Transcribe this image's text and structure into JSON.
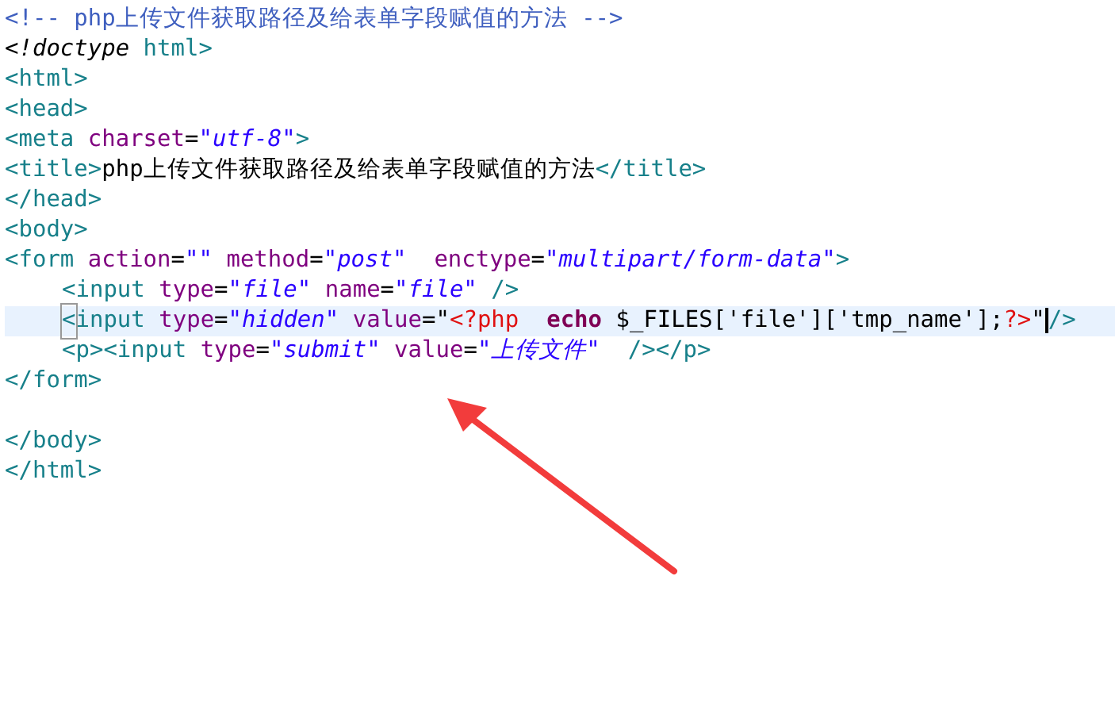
{
  "editor": {
    "lines": [
      {
        "highlighted": false,
        "tokens": [
          {
            "kind": "comment",
            "text": "<!-- php上传文件获取路径及给表单字段赋值的方法 -->"
          }
        ]
      },
      {
        "highlighted": false,
        "tokens": [
          {
            "kind": "doctype",
            "text": "<!doctype"
          },
          {
            "kind": "tag",
            "text": " html>"
          }
        ]
      },
      {
        "highlighted": false,
        "tokens": [
          {
            "kind": "tag",
            "text": "<html>"
          }
        ]
      },
      {
        "highlighted": false,
        "tokens": [
          {
            "kind": "tag",
            "text": "<head>"
          }
        ]
      },
      {
        "highlighted": false,
        "tokens": [
          {
            "kind": "tag",
            "text": "<meta "
          },
          {
            "kind": "attr",
            "text": "charset"
          },
          {
            "kind": "plain",
            "text": "="
          },
          {
            "kind": "value",
            "text": "\"utf-8\""
          },
          {
            "kind": "tag",
            "text": ">"
          }
        ]
      },
      {
        "highlighted": false,
        "tokens": [
          {
            "kind": "tag",
            "text": "<title>"
          },
          {
            "kind": "text",
            "text": "php上传文件获取路径及给表单字段赋值的方法"
          },
          {
            "kind": "tag",
            "text": "</title>"
          }
        ]
      },
      {
        "highlighted": false,
        "tokens": [
          {
            "kind": "tag",
            "text": "</head>"
          }
        ]
      },
      {
        "highlighted": false,
        "tokens": [
          {
            "kind": "tag",
            "text": "<body>"
          }
        ]
      },
      {
        "highlighted": false,
        "tokens": [
          {
            "kind": "tag",
            "text": "<form "
          },
          {
            "kind": "attr",
            "text": "action"
          },
          {
            "kind": "plain",
            "text": "="
          },
          {
            "kind": "value",
            "text": "\"\" "
          },
          {
            "kind": "attr",
            "text": "method"
          },
          {
            "kind": "plain",
            "text": "="
          },
          {
            "kind": "value",
            "text": "\"post\"  "
          },
          {
            "kind": "attr",
            "text": "enctype"
          },
          {
            "kind": "plain",
            "text": "="
          },
          {
            "kind": "value",
            "text": "\"multipart/form-data\""
          },
          {
            "kind": "tag",
            "text": ">"
          }
        ],
        "children": [
          {
            "highlighted": false,
            "tokens": [
              {
                "kind": "tag",
                "text": "<input "
              },
              {
                "kind": "attr",
                "text": "type"
              },
              {
                "kind": "plain",
                "text": "="
              },
              {
                "kind": "value",
                "text": "\"file\" "
              },
              {
                "kind": "attr",
                "text": "name"
              },
              {
                "kind": "plain",
                "text": "="
              },
              {
                "kind": "value",
                "text": "\"file\" "
              },
              {
                "kind": "tag",
                "text": "/>"
              }
            ]
          },
          {
            "highlighted": true,
            "tokens": [
              {
                "kind": "tag",
                "text": "<",
                "matched": true
              },
              {
                "kind": "tag",
                "text": "input "
              },
              {
                "kind": "attr",
                "text": "type"
              },
              {
                "kind": "plain",
                "text": "="
              },
              {
                "kind": "value",
                "text": "\"hidden\" "
              },
              {
                "kind": "attr",
                "text": "value"
              },
              {
                "kind": "plain",
                "text": "=\""
              },
              {
                "kind": "php",
                "text": "<?php  "
              },
              {
                "kind": "keyword",
                "text": "echo"
              },
              {
                "kind": "plain",
                "text": " $_FILES['file']['tmp_name'];"
              },
              {
                "kind": "php",
                "text": "?>"
              },
              {
                "kind": "plain",
                "text": "\"",
                "cursor": true
              },
              {
                "kind": "tag",
                "text": "/>"
              }
            ]
          },
          {
            "highlighted": false,
            "tokens": [
              {
                "kind": "tag",
                "text": "<p><input "
              },
              {
                "kind": "attr",
                "text": "type"
              },
              {
                "kind": "plain",
                "text": "="
              },
              {
                "kind": "value",
                "text": "\"submit\" "
              },
              {
                "kind": "attr",
                "text": "value"
              },
              {
                "kind": "plain",
                "text": "="
              },
              {
                "kind": "value",
                "text": "\"上传文件\"  "
              },
              {
                "kind": "tag",
                "text": "/></p>"
              }
            ]
          }
        ]
      },
      {
        "highlighted": false,
        "tokens": [
          {
            "kind": "tag",
            "text": "</form>"
          }
        ]
      },
      {
        "highlighted": false
      },
      {
        "highlighted": false,
        "tokens": [
          {
            "kind": "tag",
            "text": "</body>"
          }
        ]
      },
      {
        "highlighted": false,
        "tokens": [
          {
            "kind": "tag",
            "text": "</html>"
          }
        ]
      }
    ]
  }
}
